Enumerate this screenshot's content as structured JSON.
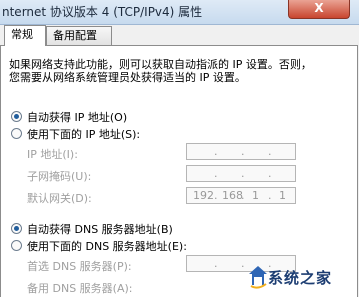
{
  "window": {
    "title": "nternet 协议版本 4 (TCP/IPv4) 属性",
    "close_glyph": "X"
  },
  "tabs": [
    {
      "label": "常规",
      "active": true
    },
    {
      "label": "备用配置",
      "active": false
    }
  ],
  "description": {
    "line1": "如果网络支持此功能，则可以获取自动指派的 IP 设置。否则，",
    "line2": "您需要从网络系统管理员处获得适当的 IP 设置。"
  },
  "ip": {
    "auto_label": "自动获得 IP 地址(O)",
    "manual_label": "使用下面的 IP 地址(S):",
    "selected": "auto",
    "fields": [
      {
        "label": "IP 地址(I):",
        "value": ""
      },
      {
        "label": "子网掩码(U):",
        "value": ""
      },
      {
        "label": "默认网关(D):",
        "octets": [
          "192",
          "168",
          "1",
          "1"
        ]
      }
    ]
  },
  "dns": {
    "auto_label": "自动获得 DNS 服务器地址(B)",
    "manual_label": "使用下面的 DNS 服务器地址(E):",
    "selected": "auto",
    "fields": [
      {
        "label": "首选 DNS 服务器(P):"
      },
      {
        "label": "备用 DNS 服务器(A):"
      }
    ]
  },
  "watermark": {
    "text": "系统之家"
  }
}
